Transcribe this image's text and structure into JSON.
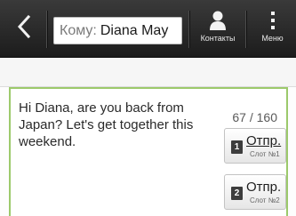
{
  "header": {
    "to_prefix": "Кому:",
    "to_name": "Diana May",
    "contacts_label": "Контакты",
    "menu_label": "Меню"
  },
  "icons": {
    "back": "chevron-left-icon",
    "contacts": "person-icon",
    "menu": "vertical-dots-icon"
  },
  "compose": {
    "message": "Hi Diana, are you back from Japan? Let's get together this weekend.",
    "char_count": "67 / 160"
  },
  "send_buttons": [
    {
      "slot_badge": "1",
      "label": "Отпр.",
      "slot_label": "Слот №1"
    },
    {
      "slot_badge": "2",
      "label": "Отпр.",
      "slot_label": "Слот №2"
    }
  ],
  "colors": {
    "topbar": "#262626",
    "compose_border": "#9cc96b"
  }
}
